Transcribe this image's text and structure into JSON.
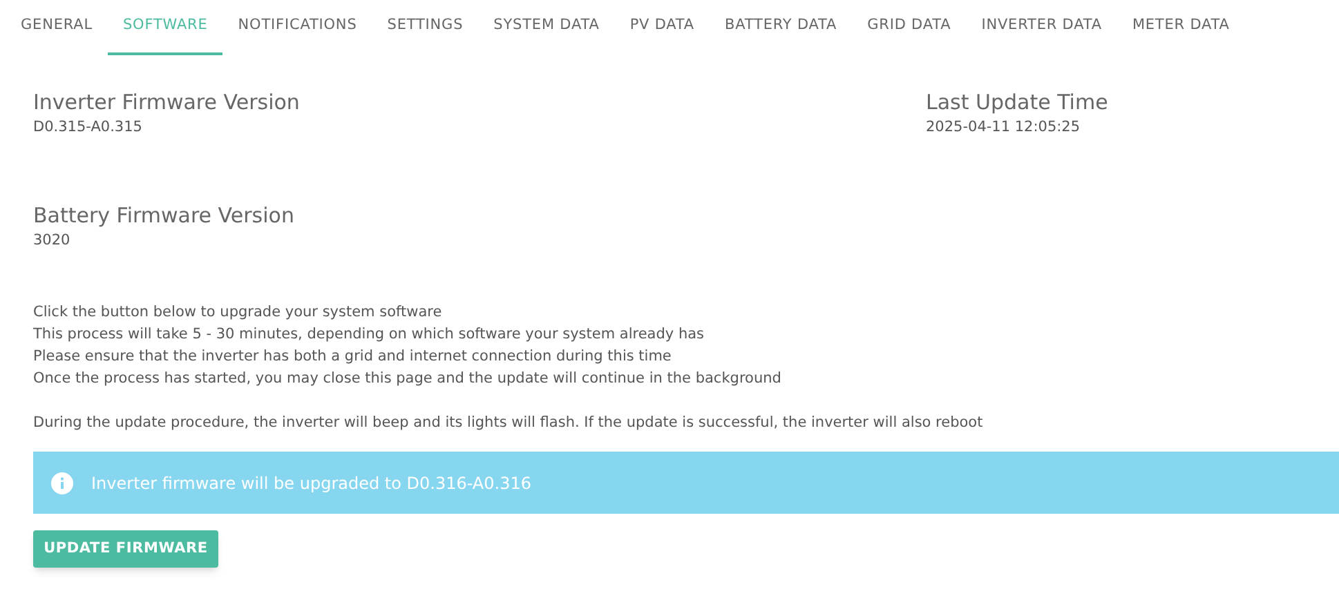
{
  "tabs": [
    {
      "label": "GENERAL",
      "selected": false
    },
    {
      "label": "SOFTWARE",
      "selected": true
    },
    {
      "label": "NOTIFICATIONS",
      "selected": false
    },
    {
      "label": "SETTINGS",
      "selected": false
    },
    {
      "label": "SYSTEM DATA",
      "selected": false
    },
    {
      "label": "PV DATA",
      "selected": false
    },
    {
      "label": "BATTERY DATA",
      "selected": false
    },
    {
      "label": "GRID DATA",
      "selected": false
    },
    {
      "label": "INVERTER DATA",
      "selected": false
    },
    {
      "label": "METER DATA",
      "selected": false
    }
  ],
  "inverter_firmware": {
    "label": "Inverter Firmware Version",
    "value": "D0.315-A0.315"
  },
  "last_update": {
    "label": "Last Update Time",
    "value": "2025-04-11 12:05:25"
  },
  "battery_firmware": {
    "label": "Battery Firmware Version",
    "value": "3020"
  },
  "instructions": [
    "Click the button below to upgrade your system software",
    "This process will take 5 - 30 minutes, depending on which software your system already has",
    "Please ensure that the inverter has both a grid and internet connection during this time",
    "Once the process has started, you may close this page and the update will continue in the background"
  ],
  "warning": "During the update procedure, the inverter will beep and its lights will flash. If the update is successful, the inverter will also reboot",
  "info_alert": "Inverter firmware will be upgraded to D0.316-A0.316",
  "update_button": "UPDATE FIRMWARE"
}
